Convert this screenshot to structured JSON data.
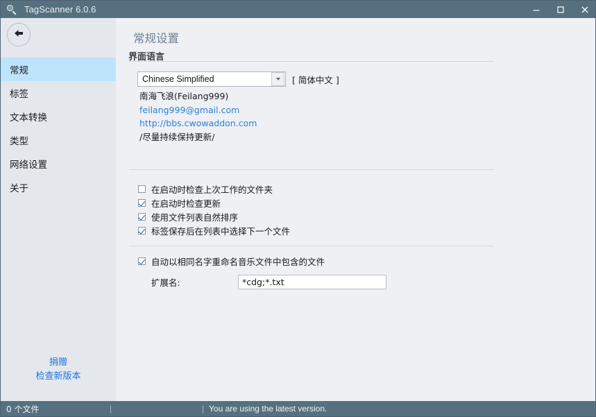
{
  "window": {
    "title": "TagScanner 6.0.6",
    "icon": "magnifier-icon",
    "minimize_label": "–",
    "maximize_label": "□",
    "close_label": "×"
  },
  "sidebar": {
    "back_button": "back-arrow",
    "items": [
      {
        "label": "常规",
        "selected": true
      },
      {
        "label": "标签",
        "selected": false
      },
      {
        "label": "文本转换",
        "selected": false
      },
      {
        "label": "类型",
        "selected": false
      },
      {
        "label": "网络设置",
        "selected": false
      },
      {
        "label": "关于",
        "selected": false
      }
    ],
    "links": [
      {
        "label": "捐赠"
      },
      {
        "label": "检查新版本"
      }
    ]
  },
  "content": {
    "page_title": "常规设置",
    "group_label": "界面语言",
    "language": {
      "selected": "Chinese Simplified",
      "options": [
        "Chinese Simplified"
      ],
      "native_label": "[ 简体中文 ]"
    },
    "credits": {
      "translator": "南海飞浪(Feilang999)",
      "email": "feilang999@gmail.com",
      "website": "http://bbs.cwowaddon.com",
      "note": "/尽量持续保持更新/"
    },
    "checkboxes": [
      {
        "label": "在启动时检查上次工作的文件夹",
        "checked": false
      },
      {
        "label": "在启动时检查更新",
        "checked": true
      },
      {
        "label": "使用文件列表自然排序",
        "checked": true
      },
      {
        "label": "标签保存后在列表中选择下一个文件",
        "checked": true
      }
    ],
    "rename": {
      "label": "自动以相同名字重命名音乐文件中包含的文件",
      "checked": true,
      "ext_label": "扩展名:",
      "ext_value": "*cdg;*.txt",
      "ext_placeholder": ""
    }
  },
  "statusbar": {
    "files": "0 个文件",
    "separator": "|",
    "version_message": "You are using the latest version."
  },
  "colors": {
    "titlebar": "#56707f",
    "sidebar": "#e4e8ed",
    "content": "#eef0f4",
    "selection": "#bde4fb",
    "link": "#1a73e8",
    "credit_link": "#2f7fd6",
    "page_title": "#6e7f93"
  }
}
